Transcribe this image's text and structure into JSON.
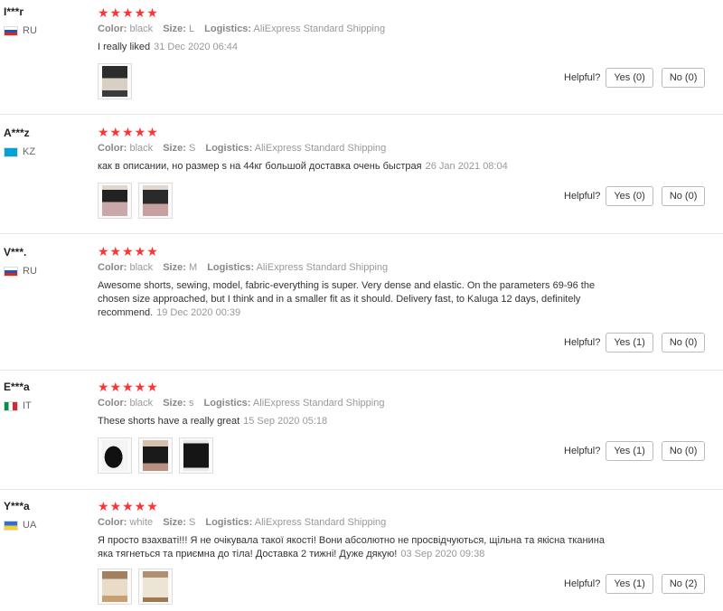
{
  "labels": {
    "color": "Color:",
    "size": "Size:",
    "logistics": "Logistics:",
    "helpful": "Helpful?"
  },
  "reviews": [
    {
      "user": "I***r",
      "country": "RU",
      "flag": [
        "#ffffff",
        "#2a4fbf",
        "#d52b1e"
      ],
      "stars": "★★★★★",
      "color": "black",
      "size": "L",
      "logistics": "AliExpress Standard Shipping",
      "text": "I really liked",
      "date": "31 Dec 2020 06:44",
      "yes": "Yes (0)",
      "no": "No (0)"
    },
    {
      "user": "A***z",
      "country": "KZ",
      "flag": [
        "#00a3d9",
        "#00a3d9",
        "#00a3d9"
      ],
      "stars": "★★★★★",
      "color": "black",
      "size": "S",
      "logistics": "AliExpress Standard Shipping",
      "text": "как в описании, но размер s на 44кг большой доставка очень быстрая",
      "date": "26 Jan 2021 08:04",
      "yes": "Yes (0)",
      "no": "No (0)"
    },
    {
      "user": "V***.",
      "country": "RU",
      "flag": [
        "#ffffff",
        "#2a4fbf",
        "#d52b1e"
      ],
      "stars": "★★★★★",
      "color": "black",
      "size": "M",
      "logistics": "AliExpress Standard Shipping",
      "text": "Awesome shorts, sewing, model, fabric-everything is super. Very dense and elastic. On the parameters 69-96 the chosen size approached, but I think and in a smaller fit as it should. Delivery fast, to Kaluga 12 days, definitely recommend.",
      "date": "19 Dec 2020 00:39",
      "yes": "Yes (1)",
      "no": "No (0)"
    },
    {
      "user": "E***a",
      "country": "IT",
      "flag": [
        "#009246",
        "#ffffff",
        "#ce2b37"
      ],
      "stars": "★★★★★",
      "color": "black",
      "size": "s",
      "logistics": "AliExpress Standard Shipping",
      "text": "These shorts have a really great",
      "date": "15 Sep 2020 05:18",
      "yes": "Yes (1)",
      "no": "No (0)"
    },
    {
      "user": "Y***a",
      "country": "UA",
      "flag": [
        "#2f6fd6",
        "#f5d22e",
        "#f5d22e"
      ],
      "stars": "★★★★★",
      "color": "white",
      "size": "S",
      "logistics": "AliExpress Standard Shipping",
      "text": "Я просто взахваті!!! Я не очікувала такої якості! Вони абсолютно не просвідчуються, щільна та якісна тканина яка тягнеться та приємна до тіла! Доставка 2 тижні! Дуже дякую!",
      "date": "03 Sep 2020 09:38",
      "yes": "Yes (1)",
      "no": "No (2)"
    }
  ],
  "thumb_colors": [
    "#3a3a3a",
    "#5a4a42",
    "#2a2a2a",
    "#c8b8a8"
  ]
}
